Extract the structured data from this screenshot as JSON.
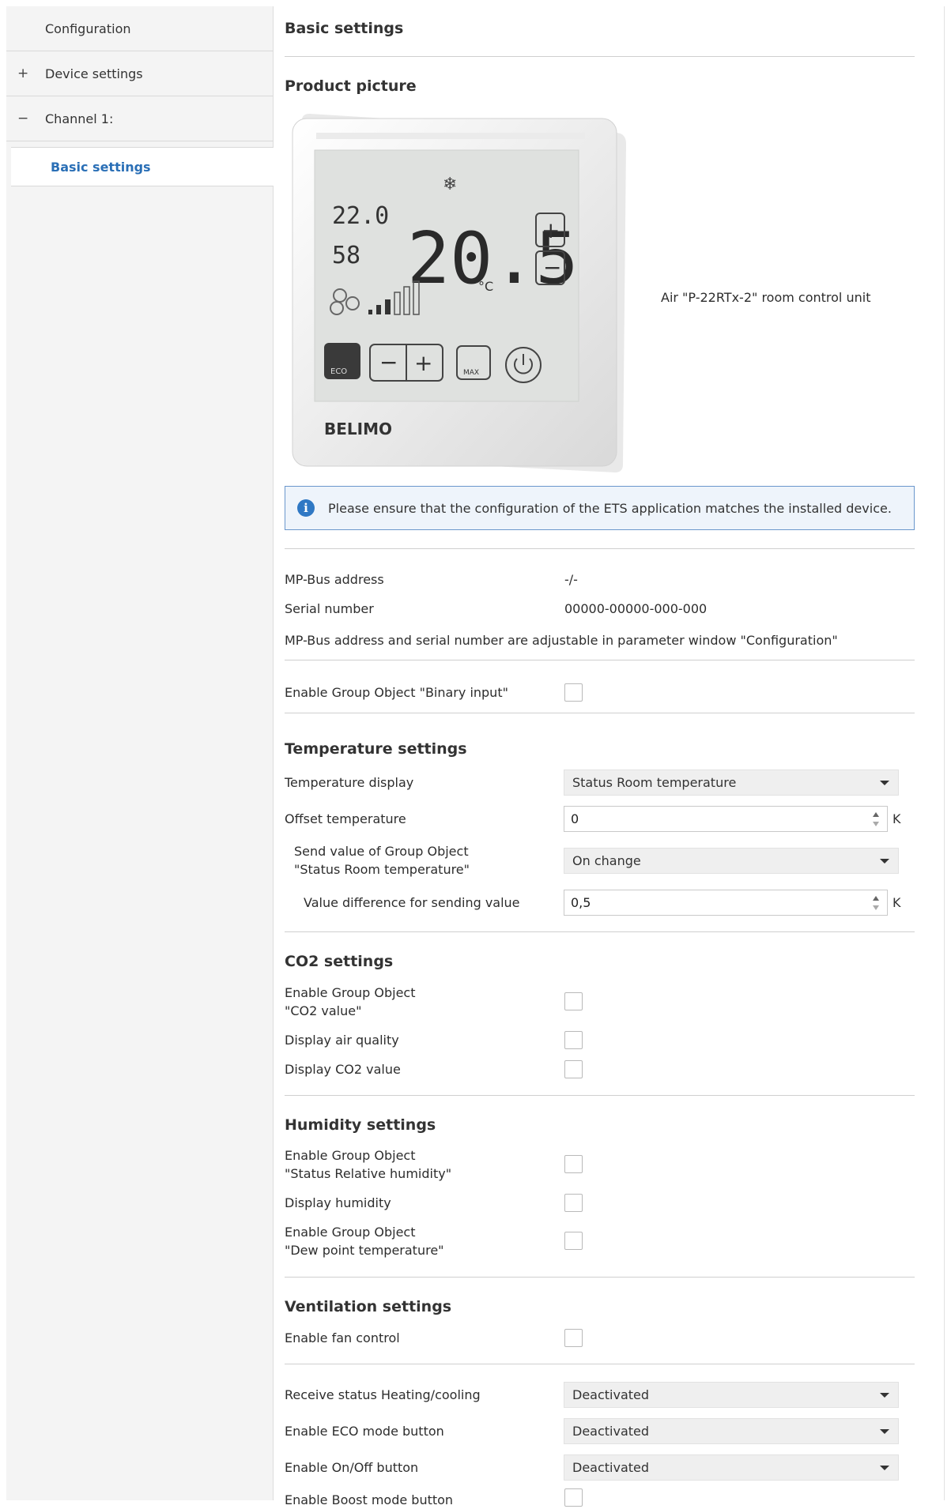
{
  "sidebar": {
    "items": [
      {
        "label": "Configuration",
        "sign": ""
      },
      {
        "label": "Device settings",
        "sign": "+"
      },
      {
        "label": "Channel 1:",
        "sign": "−"
      }
    ],
    "active": "Basic settings"
  },
  "main": {
    "title": "Basic settings",
    "product": {
      "heading": "Product picture",
      "caption": "Air \"P-22RTx-2\" room control unit",
      "device": {
        "small_temp": "22.0",
        "humidity": "58",
        "big_temp": "20.5",
        "unit": "°C",
        "eco": "ECO",
        "max": "MAX",
        "brand": "BELIMO"
      }
    },
    "info": "Please ensure that the configuration of the ETS application matches the installed device.",
    "mp_bus_label": "MP-Bus address",
    "mp_bus_value": "-/-",
    "serial_label": "Serial number",
    "serial_value": "00000-00000-000-000",
    "mp_note": "MP-Bus address and serial number are adjustable in parameter window \"Configuration\"",
    "binary_input_label": "Enable Group Object \"Binary input\"",
    "temperature": {
      "heading": "Temperature settings",
      "display_label": "Temperature display",
      "display_value": "Status Room temperature",
      "offset_label": "Offset temperature",
      "offset_value": "0",
      "offset_unit": "K",
      "send_label_1": "Send value of Group Object",
      "send_label_2": "\"Status Room temperature\"",
      "send_value": "On change",
      "diff_label": "Value difference for sending value",
      "diff_value": "0,5",
      "diff_unit": "K"
    },
    "co2": {
      "heading": "CO2 settings",
      "enable_1": "Enable Group Object",
      "enable_2": "\"CO2 value\"",
      "air_quality": "Display air quality",
      "co2_value": "Display CO2 value"
    },
    "humidity": {
      "heading": "Humidity settings",
      "enable_1": "Enable Group Object",
      "enable_2": "\"Status Relative humidity\"",
      "display": "Display humidity",
      "dew_1": "Enable Group Object",
      "dew_2": "\"Dew point temperature\""
    },
    "ventilation": {
      "heading": "Ventilation settings",
      "fan": "Enable fan control"
    },
    "misc": {
      "heating_label": "Receive status Heating/cooling",
      "heating_value": "Deactivated",
      "eco_label": "Enable ECO mode button",
      "eco_value": "Deactivated",
      "onoff_label": "Enable On/Off button",
      "onoff_value": "Deactivated",
      "boost_label": "Enable Boost mode button"
    }
  }
}
